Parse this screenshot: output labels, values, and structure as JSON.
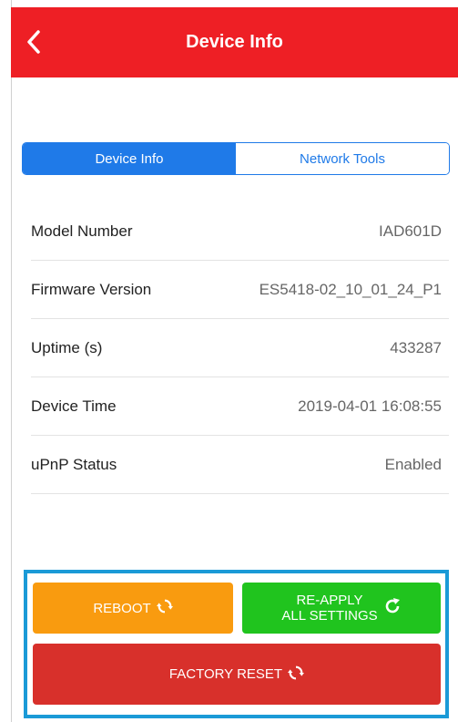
{
  "colors": {
    "header_bg": "#ee1f25",
    "accent": "#1f7ae8",
    "reboot": "#f99b0f",
    "reapply": "#20c41e",
    "factory_reset": "#d8302b",
    "panel_highlight": "#1a9ad7"
  },
  "header": {
    "back_icon": "chevron-left-icon",
    "title": "Device Info"
  },
  "tabs": [
    {
      "label": "Device Info",
      "active": true
    },
    {
      "label": "Network Tools",
      "active": false
    }
  ],
  "info": [
    {
      "label": "Model Number",
      "value": "IAD601D"
    },
    {
      "label": "Firmware Version",
      "value": "ES5418-02_10_01_24_P1"
    },
    {
      "label": "Uptime (s)",
      "value": "433287"
    },
    {
      "label": "Device Time",
      "value": "2019-04-01 16:08:55"
    },
    {
      "label": "uPnP Status",
      "value": "Enabled"
    }
  ],
  "actions": {
    "reboot_label": "REBOOT",
    "reapply_line1": "RE-APPLY",
    "reapply_line2": "ALL SETTINGS",
    "factory_reset_label": "FACTORY RESET",
    "reboot_icon": "sync-icon",
    "reapply_icon": "refresh-icon",
    "factory_reset_icon": "sync-icon"
  }
}
